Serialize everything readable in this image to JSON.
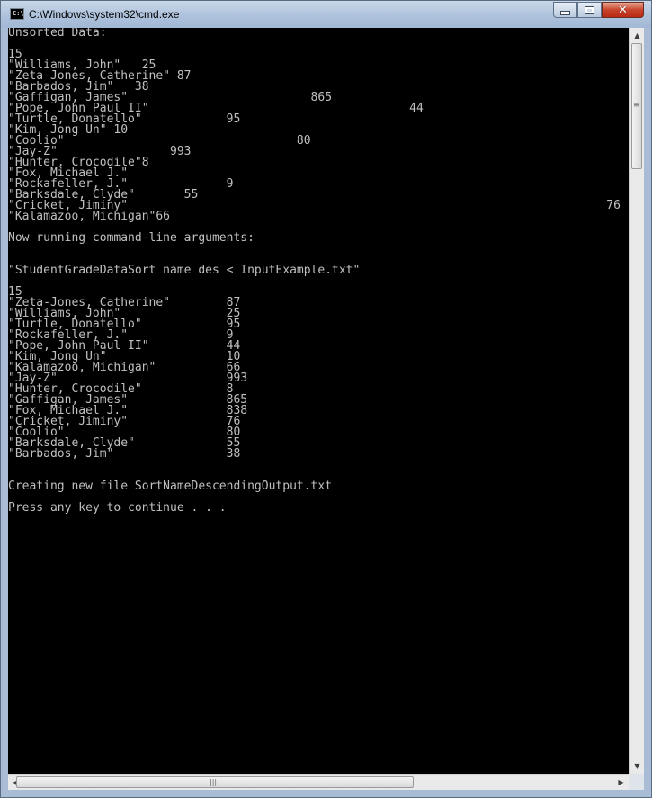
{
  "window": {
    "title": "C:\\Windows\\system32\\cmd.exe",
    "app_icon_text": "C:\\",
    "controls": {
      "minimize": "minimize",
      "maximize": "maximize",
      "close": "✕"
    }
  },
  "colors": {
    "console_bg": "#000000",
    "console_text": "#c0c0c0",
    "titlebar": "#aec2dc",
    "close_button": "#c8442b"
  },
  "console": {
    "lines": [
      "Unsorted Data:",
      "",
      "15",
      "\"Williams, John\"   25",
      "\"Zeta-Jones, Catherine\" 87",
      "\"Barbados, Jim\"   38",
      "\"Gaffigan, James\"                          865",
      "\"Pope, John Paul II\"                                     44",
      "\"Turtle, Donatello\"            95",
      "\"Kim, Jong Un\" 10",
      "\"Coolio\"                                 80",
      "\"Jay-Z\"                993",
      "\"Hunter, Crocodile\"8",
      "\"Fox, Michael J.\"",
      "\"Rockafeller, J.\"              9",
      "\"Barksdale, Clyde\"       55",
      "\"Cricket, Jiminy\"                                                                    76",
      "\"Kalamazoo, Michigan\"66",
      "",
      "Now running command-line arguments:",
      "",
      "",
      "\"StudentGradeDataSort name des < InputExample.txt\"",
      "",
      "15",
      "\"Zeta-Jones, Catherine\"        87",
      "\"Williams, John\"               25",
      "\"Turtle, Donatello\"            95",
      "\"Rockafeller, J.\"              9",
      "\"Pope, John Paul II\"           44",
      "\"Kim, Jong Un\"                 10",
      "\"Kalamazoo, Michigan\"          66",
      "\"Jay-Z\"                        993",
      "\"Hunter, Crocodile\"            8",
      "\"Gaffigan, James\"              865",
      "\"Fox, Michael J.\"              838",
      "\"Cricket, Jiminy\"              76",
      "\"Coolio\"                       80",
      "\"Barksdale, Clyde\"             55",
      "\"Barbados, Jim\"                38",
      "",
      "",
      "Creating new file SortNameDescendingOutput.txt",
      "",
      "Press any key to continue . . ."
    ]
  },
  "scrollbars": {
    "up_arrow": "▲",
    "down_arrow": "▼",
    "left_arrow": "◀",
    "right_arrow": "▶",
    "vertical_grip": "≡",
    "horizontal_grip": "|||",
    "vertical_position": 0.0,
    "horizontal_position": 0.0
  }
}
